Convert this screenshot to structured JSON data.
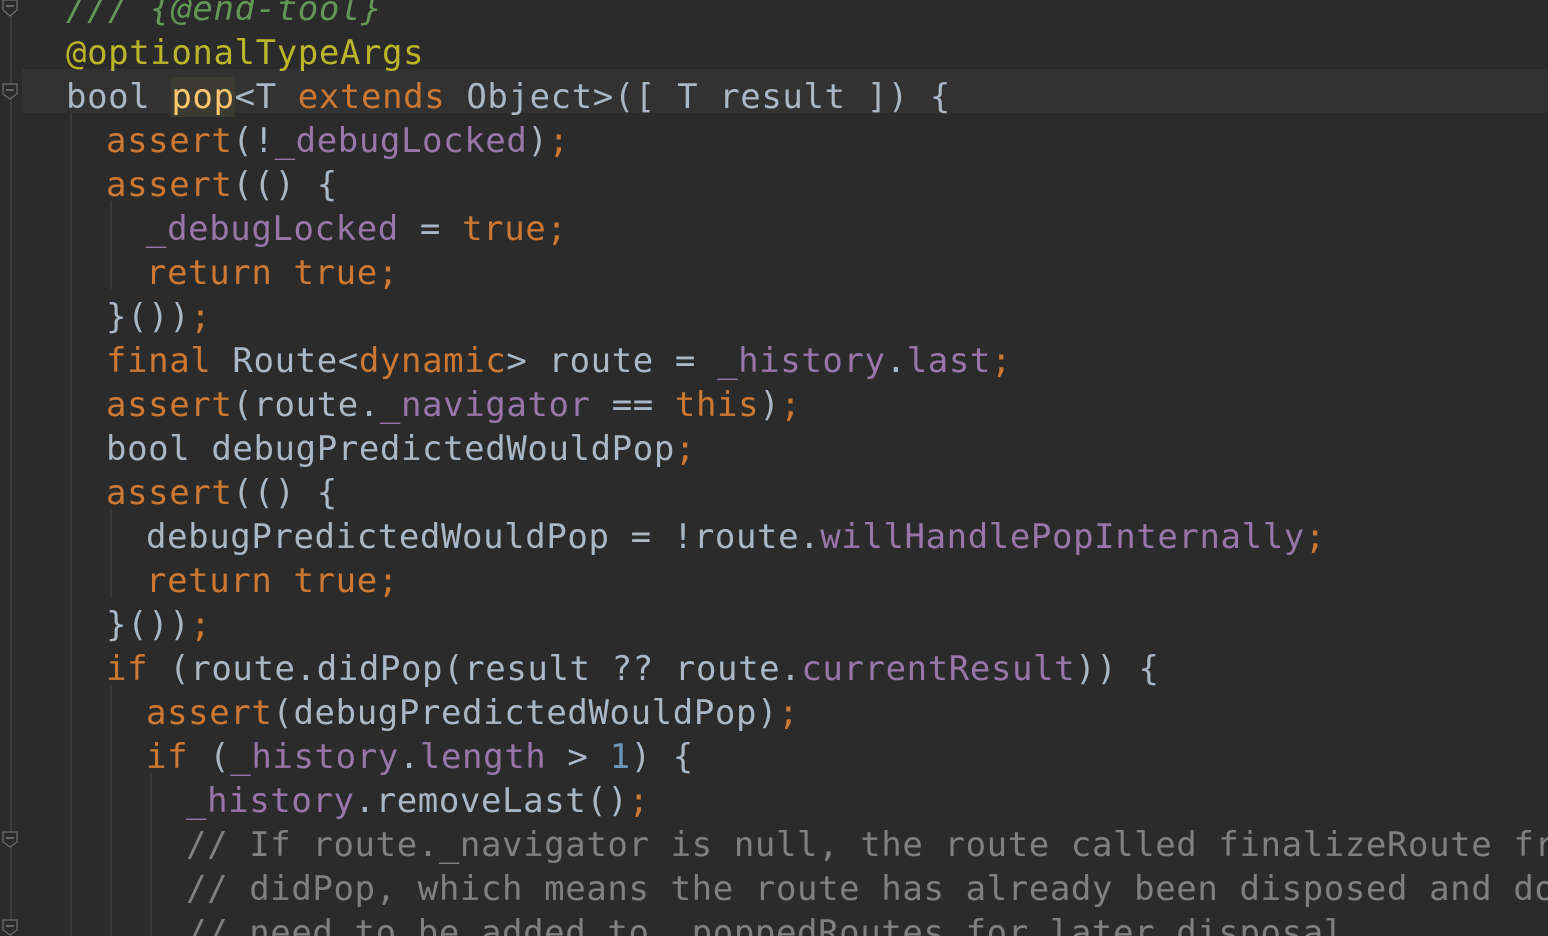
{
  "editor": {
    "language": "dart",
    "colors": {
      "background": "#2b2b2b",
      "current_line": "#323232",
      "text": "#a9b7c6",
      "keyword": "#cc7832",
      "function": "#ffc66d",
      "field": "#9876aa",
      "number": "#6897bb",
      "comment": "#808080",
      "doc_comment": "#629755",
      "annotation": "#bbb529"
    },
    "lines": [
      {
        "indent": 0,
        "tokens": [
          {
            "t": "doc",
            "v": "/// {@end-tool}"
          }
        ]
      },
      {
        "indent": 0,
        "tokens": [
          {
            "t": "ann",
            "v": "@optionalTypeArgs"
          }
        ]
      },
      {
        "indent": 0,
        "tokens": [
          {
            "t": "plain",
            "v": "bool "
          },
          {
            "t": "hl",
            "v": "pop"
          },
          {
            "t": "plain",
            "v": "<T "
          },
          {
            "t": "kw",
            "v": "extends"
          },
          {
            "t": "plain",
            "v": " Object>([ T result ]) {"
          }
        ]
      },
      {
        "indent": 1,
        "tokens": [
          {
            "t": "kw",
            "v": "assert"
          },
          {
            "t": "plain",
            "v": "(!"
          },
          {
            "t": "field",
            "v": "_debugLocked"
          },
          {
            "t": "plain",
            "v": ")"
          },
          {
            "t": "kw",
            "v": ";"
          }
        ]
      },
      {
        "indent": 1,
        "tokens": [
          {
            "t": "kw",
            "v": "assert"
          },
          {
            "t": "plain",
            "v": "(() {"
          }
        ]
      },
      {
        "indent": 2,
        "tokens": [
          {
            "t": "field",
            "v": "_debugLocked"
          },
          {
            "t": "plain",
            "v": " = "
          },
          {
            "t": "kw",
            "v": "true;"
          }
        ]
      },
      {
        "indent": 2,
        "tokens": [
          {
            "t": "kw",
            "v": "return true;"
          }
        ]
      },
      {
        "indent": 1,
        "tokens": [
          {
            "t": "plain",
            "v": "}())"
          },
          {
            "t": "kw",
            "v": ";"
          }
        ]
      },
      {
        "indent": 1,
        "tokens": [
          {
            "t": "kw",
            "v": "final"
          },
          {
            "t": "plain",
            "v": " Route<"
          },
          {
            "t": "kw",
            "v": "dynamic"
          },
          {
            "t": "plain",
            "v": "> route = "
          },
          {
            "t": "field",
            "v": "_history"
          },
          {
            "t": "plain",
            "v": "."
          },
          {
            "t": "field",
            "v": "last"
          },
          {
            "t": "kw",
            "v": ";"
          }
        ]
      },
      {
        "indent": 1,
        "tokens": [
          {
            "t": "kw",
            "v": "assert"
          },
          {
            "t": "plain",
            "v": "(route."
          },
          {
            "t": "field",
            "v": "_navigator"
          },
          {
            "t": "plain",
            "v": " == "
          },
          {
            "t": "kw",
            "v": "this"
          },
          {
            "t": "plain",
            "v": ")"
          },
          {
            "t": "kw",
            "v": ";"
          }
        ]
      },
      {
        "indent": 1,
        "tokens": [
          {
            "t": "plain",
            "v": "bool debugPredictedWouldPop"
          },
          {
            "t": "kw",
            "v": ";"
          }
        ]
      },
      {
        "indent": 1,
        "tokens": [
          {
            "t": "kw",
            "v": "assert"
          },
          {
            "t": "plain",
            "v": "(() {"
          }
        ]
      },
      {
        "indent": 2,
        "tokens": [
          {
            "t": "plain",
            "v": "debugPredictedWouldPop = !route."
          },
          {
            "t": "field",
            "v": "willHandlePopInternally"
          },
          {
            "t": "kw",
            "v": ";"
          }
        ]
      },
      {
        "indent": 2,
        "tokens": [
          {
            "t": "kw",
            "v": "return true;"
          }
        ]
      },
      {
        "indent": 1,
        "tokens": [
          {
            "t": "plain",
            "v": "}())"
          },
          {
            "t": "kw",
            "v": ";"
          }
        ]
      },
      {
        "indent": 1,
        "tokens": [
          {
            "t": "kw",
            "v": "if"
          },
          {
            "t": "plain",
            "v": " (route.didPop(result ?? route."
          },
          {
            "t": "field",
            "v": "currentResult"
          },
          {
            "t": "plain",
            "v": ")) {"
          }
        ]
      },
      {
        "indent": 2,
        "tokens": [
          {
            "t": "kw",
            "v": "assert"
          },
          {
            "t": "plain",
            "v": "(debugPredictedWouldPop)"
          },
          {
            "t": "kw",
            "v": ";"
          }
        ]
      },
      {
        "indent": 2,
        "tokens": [
          {
            "t": "kw",
            "v": "if"
          },
          {
            "t": "plain",
            "v": " ("
          },
          {
            "t": "field",
            "v": "_history"
          },
          {
            "t": "plain",
            "v": "."
          },
          {
            "t": "field",
            "v": "length"
          },
          {
            "t": "plain",
            "v": " > "
          },
          {
            "t": "num",
            "v": "1"
          },
          {
            "t": "plain",
            "v": ") {"
          }
        ]
      },
      {
        "indent": 3,
        "tokens": [
          {
            "t": "field",
            "v": "_history"
          },
          {
            "t": "plain",
            "v": ".removeLast()"
          },
          {
            "t": "kw",
            "v": ";"
          }
        ]
      },
      {
        "indent": 3,
        "tokens": [
          {
            "t": "comment",
            "v": "// If route._navigator is null, the route called finalizeRoute from"
          }
        ]
      },
      {
        "indent": 3,
        "tokens": [
          {
            "t": "comment",
            "v": "// didPop, which means the route has already been disposed and doesn"
          }
        ]
      },
      {
        "indent": 3,
        "tokens": [
          {
            "t": "comment",
            "v": "// need to be added to _poppedRoutes for later disposal."
          }
        ]
      }
    ]
  }
}
